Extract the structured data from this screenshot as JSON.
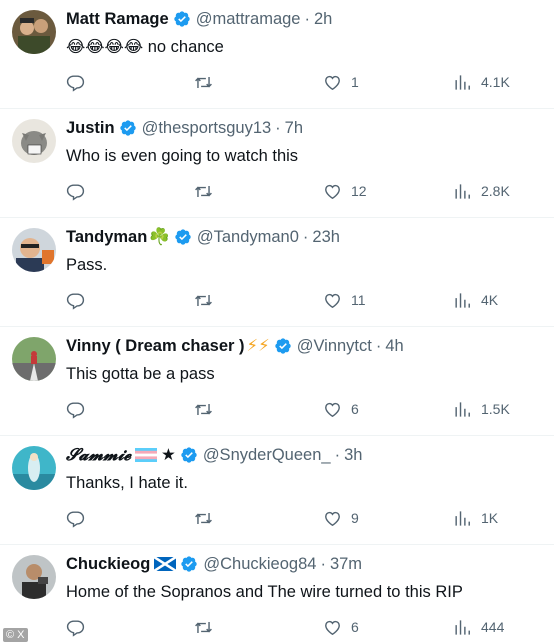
{
  "tweets": [
    {
      "name": "Matt Ramage",
      "decoration": "",
      "handle": "@mattramage",
      "time": "2h",
      "text": "😂😂😂😂  no chance",
      "replies": "",
      "retweets": "",
      "likes": "1",
      "views": "4.1K"
    },
    {
      "name": "Justin",
      "decoration": "",
      "handle": "@thesportsguy13",
      "time": "7h",
      "text": "Who is even going to watch this",
      "replies": "",
      "retweets": "",
      "likes": "12",
      "views": "2.8K"
    },
    {
      "name": "Tandyman",
      "decoration": "☘️",
      "handle": "@Tandyman0",
      "time": "23h",
      "text": "Pass.",
      "replies": "",
      "retweets": "",
      "likes": "11",
      "views": "4K"
    },
    {
      "name": "Vinny ( Dream chaser )",
      "decoration": "⚡⚡",
      "handle": "@Vinnytct",
      "time": "4h",
      "text": "This gotta be a pass",
      "replies": "",
      "retweets": "",
      "likes": "6",
      "views": "1.5K"
    },
    {
      "name": "𝓢𝓪𝓶𝓶𝓲𝓮",
      "decoration": "★",
      "handle": "@SnyderQueen_",
      "time": "3h",
      "text": "Thanks, I hate it.",
      "replies": "",
      "retweets": "",
      "likes": "9",
      "views": "1K"
    },
    {
      "name": "Chuckieog",
      "decoration": "",
      "handle": "@Chuckieog84",
      "time": "37m",
      "text": "Home of the Sopranos and The wire turned to this RIP",
      "replies": "",
      "retweets": "",
      "likes": "6",
      "views": "444"
    }
  ],
  "credit": "© X",
  "colors": {
    "verified": "#1d9bf0",
    "muted": "#536471",
    "text": "#0f1419",
    "divider": "#eff3f4"
  },
  "icons": [
    "reply-icon",
    "retweet-icon",
    "like-icon",
    "views-icon",
    "verified-badge-icon"
  ]
}
